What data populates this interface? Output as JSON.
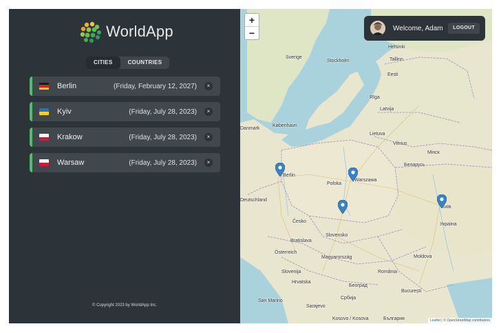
{
  "app": {
    "name": "WorldApp",
    "copyright": "© Copyright 2023 by WorldApp Inc."
  },
  "tabs": [
    {
      "label": "CITIES",
      "active": true
    },
    {
      "label": "COUNTRIES",
      "active": false
    }
  ],
  "cities": [
    {
      "name": "Berlin",
      "date": "(Friday, February 12, 2027)",
      "flag": "germany-flag",
      "delete_label": "×"
    },
    {
      "name": "Kyiv",
      "date": "(Friday, July 28, 2023)",
      "flag": "ukraine-flag",
      "delete_label": "×"
    },
    {
      "name": "Krakow",
      "date": "(Friday, July 28, 2023)",
      "flag": "poland-flag",
      "delete_label": "×"
    },
    {
      "name": "Warsaw",
      "date": "(Friday, July 28, 2023)",
      "flag": "poland-flag",
      "delete_label": "×"
    }
  ],
  "user": {
    "welcome": "Welcome, Adam",
    "logout_label": "LOGOUT"
  },
  "map": {
    "zoom_in": "+",
    "zoom_out": "−",
    "attribution_leaflet": "Leaflet",
    "attribution_osm": "© OpenStreetMap contributors",
    "labels": {
      "sverige": "Sverige",
      "stockholm": "Stockholm",
      "helsinki": "Helsinki",
      "tallinn": "Tallinn",
      "eesti": "Eesti",
      "latvija": "Latvija",
      "riga": "Rīga",
      "lietuva": "Lietuva",
      "vilnius": "Vilnius",
      "danmark": "Danmark",
      "kobenhavn": "København",
      "berlin": "Berlin",
      "polska": "Polska",
      "warszawa": "Warszawa",
      "belarus": "Беларусь",
      "minsk": "Мінск",
      "deutschland": "Deutschland",
      "cesko": "Česko",
      "slovensko": "Slovensko",
      "kyiv": "Київ",
      "ukraina": "Україна",
      "bratislava": "Bratislava",
      "osterreich": "Österreich",
      "magyarorszag": "Magyarország",
      "moldova": "Moldova",
      "slovenija": "Slovenija",
      "hrvatska": "Hrvatska",
      "beograd": "Београд",
      "romania": "România",
      "bucuresti": "București",
      "srbija": "Србија",
      "sanmarino": "San Marino",
      "sarajevo": "Sarajevo",
      "kosovo": "Kosovo / Kosova",
      "bulgaria": "България"
    }
  },
  "colors": {
    "sidebar_bg": "#2d3439",
    "accent_green": "#4fbf68",
    "item_bg": "#40474d",
    "marker_blue": "#3b82c4"
  }
}
